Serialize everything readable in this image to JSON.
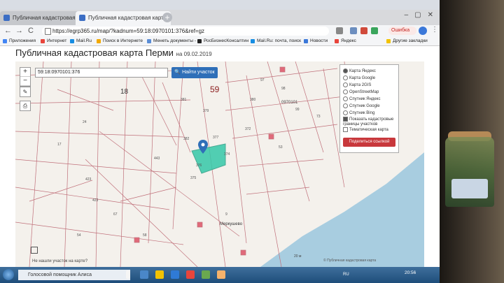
{
  "browser": {
    "tabs": [
      {
        "label": "Публичная кадастровая карта",
        "active": false
      },
      {
        "label": "Публичная кадастровая карта",
        "active": true
      }
    ],
    "new_tab_symbol": "+",
    "url": "https://egrp365.ru/map/?kadnum=59:18:0970101:376&ref=gz",
    "error_button": "Ошибка",
    "nav": {
      "back": "←",
      "forward": "→",
      "reload": "C"
    },
    "bookmarks": [
      {
        "label": "Приложения",
        "color": "#4285f4"
      },
      {
        "label": "Интернет",
        "color": "#e8453c"
      },
      {
        "label": "Mail.Ru",
        "color": "#168de2"
      },
      {
        "label": "Поиск в Интернете",
        "color": "#f2a900"
      },
      {
        "label": "Менеть документы - ",
        "color": "#5a8dd6"
      },
      {
        "label": "РосБизнесКонсалтин",
        "color": "#222222"
      },
      {
        "label": "Mail.Ru: почта, поиск",
        "color": "#168de2"
      },
      {
        "label": "Новости",
        "color": "#3b78d9"
      },
      {
        "label": "Яндекс",
        "color": "#e8453c"
      },
      {
        "label": "Другие закладки",
        "color": "#f2c200"
      }
    ]
  },
  "page": {
    "title": "Публичная кадастровая карта Перми",
    "date": "на 09.02.2019"
  },
  "map": {
    "search_value": "59:18:0970101:376",
    "find_button": "Найти участок",
    "zoom_in": "+",
    "zoom_out": "−",
    "layers": [
      {
        "label": "Карта Яндекс",
        "selected": true
      },
      {
        "label": "Карта Google",
        "selected": false
      },
      {
        "label": "Карта 2GIS",
        "selected": false
      },
      {
        "label": "OpenStreetMap",
        "selected": false
      },
      {
        "label": "Спутник Яндекс",
        "selected": false
      },
      {
        "label": "Спутник Google",
        "selected": false
      },
      {
        "label": "Спутник Bing",
        "selected": false
      }
    ],
    "checkboxes": [
      {
        "label": "Показать кадастровые границы участков",
        "checked": true
      },
      {
        "label": "Тематическая карта",
        "checked": false
      }
    ],
    "share_button": "Поделиться ссылкой",
    "parcel_labels": [
      "376",
      "375",
      "377",
      "379",
      "381",
      "380",
      "382",
      "443",
      "423",
      "423",
      "54",
      "67",
      "58",
      "374",
      "372",
      "18",
      "59",
      "97",
      "98",
      "99",
      "53",
      "73",
      "24",
      "17",
      "9"
    ],
    "quarter_label_1": "18",
    "quarter_label_2": "59",
    "block_label": "0970101",
    "place_label": "Меркушево",
    "not_found_text": "Не нашли участок на карте?",
    "copyright": "© Публичная кадастровая карта",
    "scale": "20 м",
    "colors": {
      "boundary": "#c0707a",
      "selected_parcel": "#35c9a8",
      "marker": "#2f6fb8",
      "water": "#a8cde0"
    }
  },
  "taskbar": {
    "search_placeholder": "Голосовой помощник Алиса",
    "tray_lang": "RU",
    "time": "20:56"
  }
}
